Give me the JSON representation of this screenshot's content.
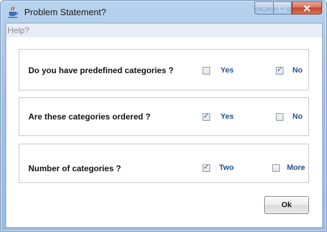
{
  "window": {
    "title": "Problem Statement?",
    "app_icon": "java-cup-icon",
    "controls": {
      "minimize": "minimize-icon",
      "maximize": "maximize-icon",
      "close": "close-icon"
    }
  },
  "menubar": {
    "help_label": "Help?"
  },
  "questions": [
    {
      "text": "Do you have predefined categories ?",
      "options": [
        {
          "label": "Yes",
          "checked": false
        },
        {
          "label": "No",
          "checked": true
        }
      ]
    },
    {
      "text": "Are these categories ordered ?",
      "options": [
        {
          "label": "Yes",
          "checked": true
        },
        {
          "label": "No",
          "checked": false
        }
      ]
    },
    {
      "text": "Number of categories ?",
      "options": [
        {
          "label": "Two",
          "checked": true
        },
        {
          "label": "More",
          "checked": false
        }
      ]
    }
  ],
  "footer": {
    "ok_label": "Ok"
  },
  "colors": {
    "option_text": "#1f4f97",
    "titlebar": "#a3c1e3",
    "close_button": "#c4452a"
  }
}
